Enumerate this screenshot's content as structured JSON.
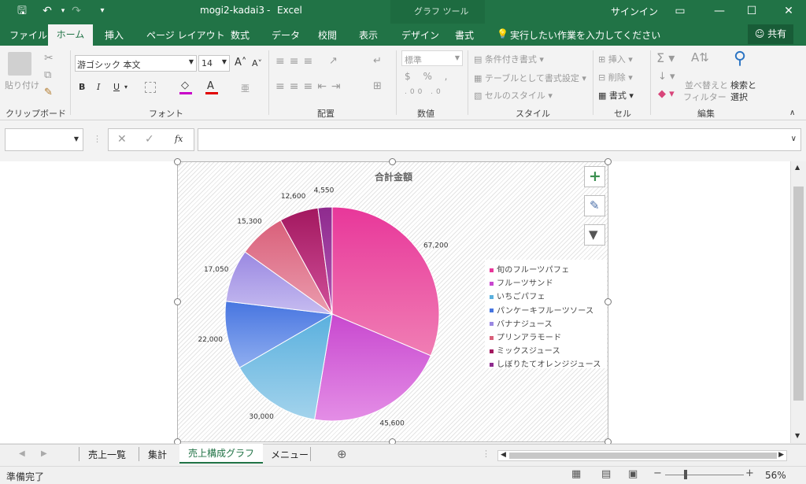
{
  "title": {
    "file": "mogi2-kadai3",
    "dash": "-",
    "app": "Excel",
    "context_tools": "グラフ ツール",
    "signin": "サインイン"
  },
  "tabs": {
    "file": "ファイル",
    "home": "ホーム",
    "insert": "挿入",
    "page_layout": "ページ レイアウト",
    "formulas": "数式",
    "data": "データ",
    "review": "校閲",
    "view": "表示",
    "design": "デザイン",
    "format": "書式",
    "tell_me": "実行したい作業を入力してください",
    "share": "共有"
  },
  "ribbon": {
    "clipboard": {
      "paste": "貼り付け",
      "label": "クリップボード"
    },
    "font": {
      "name": "游ゴシック 本文",
      "size": "14",
      "bold": "B",
      "italic": "I",
      "underline": "U",
      "label": "フォント"
    },
    "alignment": {
      "label": "配置"
    },
    "number": {
      "format": "標準",
      "label": "数値"
    },
    "styles": {
      "conditional": "条件付き書式",
      "as_table": "テーブルとして書式設定",
      "cell_styles": "セルのスタイル",
      "label": "スタイル"
    },
    "cells": {
      "insert": "挿入",
      "delete": "削除",
      "format": "書式",
      "label": "セル"
    },
    "editing": {
      "sort_filter_1": "並べ替えと",
      "sort_filter_2": "フィルター",
      "find_1": "検索と",
      "find_2": "選択",
      "label": "編集"
    }
  },
  "formula_bar": {
    "name_box": "",
    "fx": "fx",
    "formula": ""
  },
  "chart_data": {
    "type": "pie",
    "title": "合計金額",
    "categories": [
      "旬のフルーツパフェ",
      "フルーツサンド",
      "いちごパフェ",
      "パンケーキフルーツソース",
      "バナナジュース",
      "プリンアラモード",
      "ミックスジュース",
      "しぼりたてオレンジジュース"
    ],
    "values": [
      67200,
      45600,
      30000,
      22000,
      17050,
      15300,
      12600,
      4550
    ],
    "data_labels": [
      "67,200",
      "45,600",
      "30,000",
      "22,000",
      "17,050",
      "15,300",
      "12,600",
      "4,550"
    ],
    "colors": [
      [
        "#e8379a",
        "#f07eb4"
      ],
      [
        "#c848cf",
        "#e48ee6"
      ],
      [
        "#5ab0de",
        "#a3d3ec"
      ],
      [
        "#4775e0",
        "#90aef0"
      ],
      [
        "#9a88e2",
        "#c6bcf0"
      ],
      [
        "#d9607a",
        "#eb9cae"
      ],
      [
        "#a3185f",
        "#d0509a"
      ],
      [
        "#8e2b8e",
        "#b455b4"
      ]
    ],
    "legend_position": "right"
  },
  "sheet_tabs": [
    "売上一覧",
    "集計",
    "売上構成グラフ",
    "メニュー"
  ],
  "active_sheet": "売上構成グラフ",
  "status": {
    "ready": "準備完了",
    "zoom": "56%"
  }
}
